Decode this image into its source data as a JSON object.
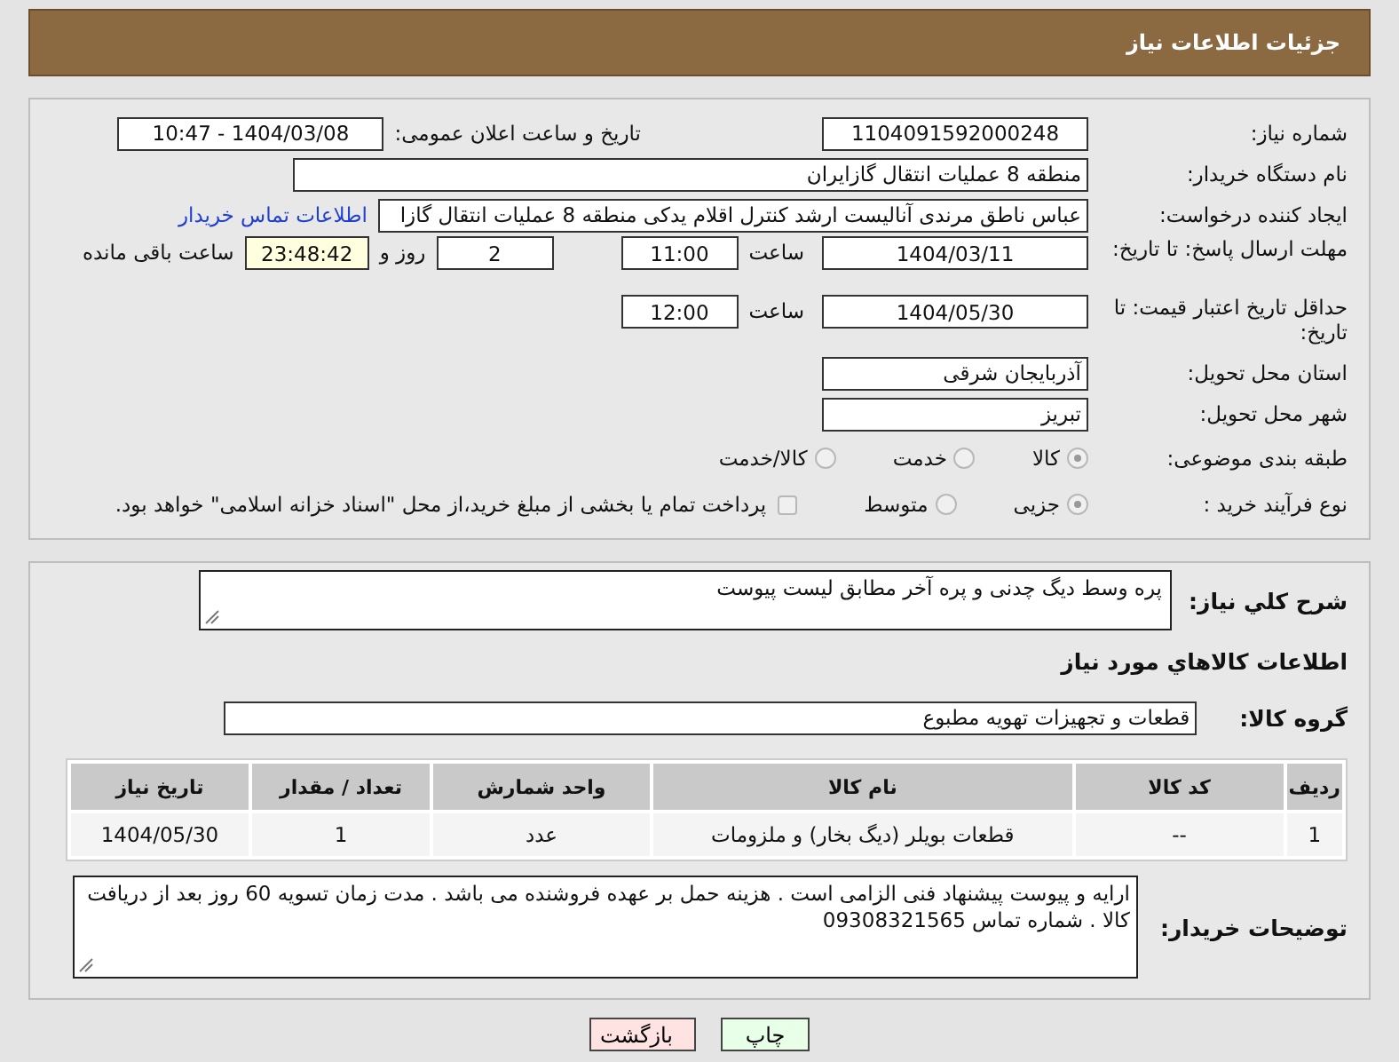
{
  "header": {
    "title": "جزئیات اطلاعات نیاز"
  },
  "need_number": {
    "label": "شماره نیاز:",
    "value": "1104091592000248"
  },
  "announce": {
    "label": "تاریخ و ساعت اعلان عمومی:",
    "value": "1404/03/08 - 10:47"
  },
  "buyer_org": {
    "label": "نام دستگاه خریدار:",
    "value": "منطقه 8 عملیات انتقال گازایران"
  },
  "requester": {
    "label": "ایجاد کننده درخواست:",
    "value": "عباس ناطق مرندی آنالیست ارشد کنترل اقلام یدکی منطقه 8 عملیات انتقال گازا",
    "link": "اطلاعات تماس خریدار"
  },
  "reply_deadline": {
    "label": "مهلت ارسال پاسخ: تا تاریخ:",
    "date": "1404/03/11",
    "time_label": "ساعت",
    "time": "11:00",
    "days": "2",
    "days_label": "روز و",
    "remaining": "23:48:42",
    "remaining_label": "ساعت باقی مانده"
  },
  "price_validity": {
    "label": "حداقل تاریخ اعتبار قیمت: تا تاریخ:",
    "date": "1404/05/30",
    "time_label": "ساعت",
    "time": "12:00"
  },
  "province": {
    "label": "استان محل تحویل:",
    "value": "آذربایجان شرقی"
  },
  "city": {
    "label": "شهر محل تحویل:",
    "value": "تبریز"
  },
  "category": {
    "label": "طبقه بندی موضوعی:",
    "options": [
      {
        "label": "کالا",
        "selected": true
      },
      {
        "label": "خدمت",
        "selected": false
      },
      {
        "label": "کالا/خدمت",
        "selected": false
      }
    ]
  },
  "purchase_process": {
    "label": "نوع فرآیند خرید :",
    "options": [
      {
        "label": "جزیی",
        "selected": true
      },
      {
        "label": "متوسط",
        "selected": false
      }
    ],
    "payment": {
      "label": "پرداخت تمام یا بخشی از مبلغ خرید،از محل \"اسناد خزانه اسلامی\" خواهد بود.",
      "checked": false
    }
  },
  "general_description": {
    "label": "شرح کلي نیاز:",
    "value": "پره وسط دیگ چدنی و پره آخر مطابق لیست پیوست"
  },
  "goods_heading": "اطلاعات کالاهاي مورد نیاز",
  "goods_group": {
    "label": "گروه کالا:",
    "value": "قطعات و تجهیزات تهویه مطبوع"
  },
  "table": {
    "columns": [
      "ردیف",
      "کد کالا",
      "نام کالا",
      "واحد شمارش",
      "تعداد / مقدار",
      "تاریخ نیاز"
    ],
    "rows": [
      [
        "1",
        "--",
        "قطعات بویلر (دیگ بخار) و ملزومات",
        "عدد",
        "1",
        "1404/05/30"
      ]
    ]
  },
  "buyer_notes": {
    "label": "توضیحات خریدار:",
    "value": "ارایه و پیوست پیشنهاد فنی الزامی است . هزینه حمل بر عهده فروشنده می باشد . مدت زمان تسویه 60 روز بعد از دریافت کالا . شماره تماس 09308321565"
  },
  "buttons": [
    {
      "label": "چاپ",
      "kind": "print"
    },
    {
      "label": "بازگشت",
      "kind": "back"
    }
  ]
}
